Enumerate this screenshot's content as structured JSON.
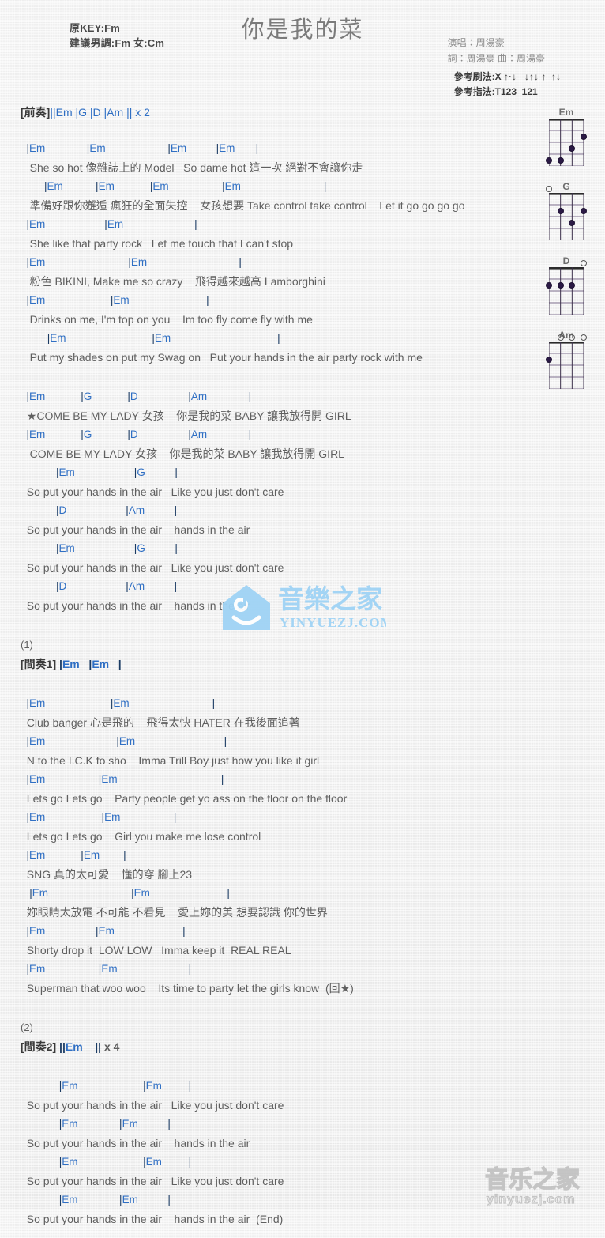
{
  "header": {
    "title": "你是我的菜",
    "original_key_label": "原KEY:Fm",
    "suggested_key_label": "建議男調:Fm 女:Cm",
    "singer": "演唱：周湯豪",
    "writer": "詞：周湯豪  曲：周湯豪",
    "strum_pattern": "參考刷法:X ↑·↓ _↓↑↓ ↑_↑↓",
    "fingerstyle_pattern": "參考指法:T123_121"
  },
  "intro": {
    "label": "[前奏]",
    "bars": "||Em  |G  |D  |Am  || x 2"
  },
  "diagrams": [
    {
      "name": "Em",
      "open_strings": [],
      "dots": [
        {
          "string": 1,
          "fret": 4
        },
        {
          "string": 2,
          "fret": 4
        },
        {
          "string": 3,
          "fret": 3
        },
        {
          "string": 4,
          "fret": 2
        }
      ]
    },
    {
      "name": "G",
      "open_strings": [
        1
      ],
      "dots": [
        {
          "string": 2,
          "fret": 2
        },
        {
          "string": 3,
          "fret": 3
        },
        {
          "string": 4,
          "fret": 2
        }
      ]
    },
    {
      "name": "D",
      "open_strings": [
        4
      ],
      "dots": [
        {
          "string": 1,
          "fret": 2
        },
        {
          "string": 2,
          "fret": 2
        },
        {
          "string": 3,
          "fret": 2
        }
      ]
    },
    {
      "name": "Am",
      "open_strings": [
        2,
        3,
        4
      ],
      "dots": [
        {
          "string": 1,
          "fret": 2
        }
      ]
    }
  ],
  "sections": [
    {
      "id": "verse1",
      "lines": [
        {
          "type": "chord",
          "text": "  |Em              |Em                     |Em          |Em       |"
        },
        {
          "type": "lyric",
          "text": "   She so hot 像雜誌上的 Model   So dame hot 這一次 絕對不會讓你走"
        },
        {
          "type": "chord",
          "text": "        |Em           |Em            |Em                  |Em                            |"
        },
        {
          "type": "lyric",
          "text": "   準備好跟你邂逅 瘋狂的全面失控    女孩想要 Take control take control    Let it go go go go"
        },
        {
          "type": "chord",
          "text": "  |Em                    |Em                        |"
        },
        {
          "type": "lyric",
          "text": "   She like that party rock   Let me touch that I can't stop"
        },
        {
          "type": "chord",
          "text": "  |Em                            |Em                               |"
        },
        {
          "type": "lyric",
          "text": "   粉色 BIKINI, Make me so crazy    飛得越來越高 Lamborghini"
        },
        {
          "type": "chord",
          "text": "  |Em                      |Em                          |"
        },
        {
          "type": "lyric",
          "text": "   Drinks on me, I'm top on you    Im too fly come fly with me"
        },
        {
          "type": "chord",
          "text": "         |Em                             |Em                                    |"
        },
        {
          "type": "lyric",
          "text": "   Put my shades on put my Swag on   Put your hands in the air party rock with me"
        }
      ]
    },
    {
      "id": "chorus1",
      "lines": [
        {
          "type": "chord",
          "text": "  |Em            |G            |D                 |Am              |"
        },
        {
          "type": "lyric",
          "text": "  ★COME BE MY LADY 女孩    你是我的菜 BABY 讓我放得開 GIRL"
        },
        {
          "type": "chord",
          "text": "  |Em            |G            |D                 |Am              |"
        },
        {
          "type": "lyric",
          "text": "   COME BE MY LADY 女孩    你是我的菜 BABY 讓我放得開 GIRL"
        },
        {
          "type": "chord",
          "text": "            |Em                    |G          |"
        },
        {
          "type": "lyric",
          "text": "  So put your hands in the air   Like you just don't care"
        },
        {
          "type": "chord",
          "text": "            |D                    |Am          |"
        },
        {
          "type": "lyric",
          "text": "  So put your hands in the air    hands in the air"
        },
        {
          "type": "chord",
          "text": "            |Em                    |G          |"
        },
        {
          "type": "lyric",
          "text": "  So put your hands in the air   Like you just don't care"
        },
        {
          "type": "chord",
          "text": "            |D                    |Am          |"
        },
        {
          "type": "lyric",
          "text": "  So put your hands in the air    hands in the air"
        }
      ]
    },
    {
      "id": "interlude1",
      "number": "(1)",
      "lines": [
        {
          "type": "meta",
          "text": "[間奏1] |Em   |Em   |"
        }
      ]
    },
    {
      "id": "verse2",
      "lines": [
        {
          "type": "chord",
          "text": "  |Em                      |Em                            |"
        },
        {
          "type": "lyric",
          "text": "  Club banger 心是飛的    飛得太快 HATER 在我後面追著"
        },
        {
          "type": "chord",
          "text": "  |Em                        |Em                              |"
        },
        {
          "type": "lyric",
          "text": "  N to the I.C.K fo sho    Imma Trill Boy just how you like it girl"
        },
        {
          "type": "chord",
          "text": "  |Em                  |Em                                   |"
        },
        {
          "type": "lyric",
          "text": "  Lets go Lets go    Party people get yo ass on the floor on the floor"
        },
        {
          "type": "chord",
          "text": "  |Em                   |Em                  |"
        },
        {
          "type": "lyric",
          "text": "  Lets go Lets go    Girl you make me lose control"
        },
        {
          "type": "chord",
          "text": "  |Em            |Em        |"
        },
        {
          "type": "lyric",
          "text": "  SNG 真的太可愛    懂的穿 腳上23"
        },
        {
          "type": "chord",
          "text": "   |Em                            |Em                          |"
        },
        {
          "type": "lyric",
          "text": "  妳眼睛太放電 不可能 不看見    愛上妳的美 想要認識 你的世界"
        },
        {
          "type": "chord",
          "text": "  |Em                 |Em                       |"
        },
        {
          "type": "lyric",
          "text": "  Shorty drop it  LOW LOW   Imma keep it  REAL REAL"
        },
        {
          "type": "chord",
          "text": "  |Em                  |Em                        |"
        },
        {
          "type": "lyric",
          "text": "  Superman that woo woo    Its time to party let the girls know  (回★)"
        }
      ]
    },
    {
      "id": "interlude2",
      "number": "(2)",
      "lines": [
        {
          "type": "meta",
          "text": "[間奏2] ||Em    || x 4"
        }
      ]
    },
    {
      "id": "outro",
      "lines": [
        {
          "type": "chord",
          "text": "             |Em                      |Em         |"
        },
        {
          "type": "lyric",
          "text": "  So put your hands in the air   Like you just don't care"
        },
        {
          "type": "chord",
          "text": "             |Em              |Em          |"
        },
        {
          "type": "lyric",
          "text": "  So put your hands in the air    hands in the air"
        },
        {
          "type": "chord",
          "text": "             |Em                      |Em         |"
        },
        {
          "type": "lyric",
          "text": "  So put your hands in the air   Like you just don't care"
        },
        {
          "type": "chord",
          "text": "             |Em              |Em          |"
        },
        {
          "type": "lyric",
          "text": "  So put your hands in the air    hands in the air  (End)"
        }
      ]
    }
  ],
  "watermark": {
    "center_cn": "音樂之家",
    "center_url": "YINYUEZJ.COM",
    "corner_cn": "音乐之家",
    "corner_url": "yinyuezj.com",
    "center_color": "#9fd3f5",
    "corner_color": "#bdbdbd"
  }
}
